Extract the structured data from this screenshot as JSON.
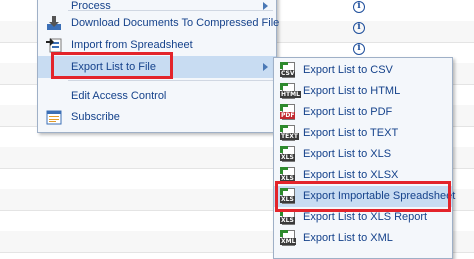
{
  "main_menu": {
    "items": [
      {
        "label": "Process",
        "has_submenu": true
      },
      {
        "label": "Download Documents To Compressed File",
        "has_submenu": false
      },
      {
        "label": "Import from Spreadsheet",
        "has_submenu": false
      },
      {
        "label": "Export List to File",
        "has_submenu": true,
        "active": true
      },
      {
        "label": "Edit Access Control",
        "has_submenu": false
      },
      {
        "label": "Subscribe",
        "has_submenu": false
      }
    ]
  },
  "export_submenu": {
    "items": [
      {
        "label": "Export List to CSV",
        "icon_tag": "CSV",
        "tag_color": "#3a3a3a"
      },
      {
        "label": "Export List to HTML",
        "icon_tag": "HTML",
        "tag_color": "#3a3a3a"
      },
      {
        "label": "Export List to PDF",
        "icon_tag": "PDF",
        "tag_color": "#c0272d"
      },
      {
        "label": "Export List to TEXT",
        "icon_tag": "TEXT",
        "tag_color": "#3a3a3a"
      },
      {
        "label": "Export List to XLS",
        "icon_tag": "XLS",
        "tag_color": "#3a3a3a"
      },
      {
        "label": "Export List to XLSX",
        "icon_tag": "XLS",
        "tag_color": "#3a3a3a"
      },
      {
        "label": "Export Importable Spreadsheet",
        "icon_tag": "XLS",
        "tag_color": "#3a3a3a",
        "active": true
      },
      {
        "label": "Export List to XLS Report",
        "icon_tag": "XLS",
        "tag_color": "#3a3a3a"
      },
      {
        "label": "Export List to XML",
        "icon_tag": "XML",
        "tag_color": "#3a3a3a"
      }
    ]
  },
  "info_icon_glyph": "i",
  "colors": {
    "highlight": "#e3242b",
    "menu_text": "#15428b",
    "active_bg": "#c8dcf2"
  }
}
